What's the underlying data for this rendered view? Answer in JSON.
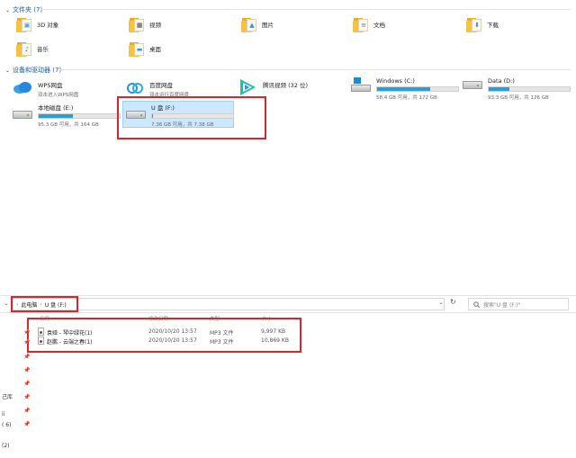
{
  "folders_section": {
    "title": "文件夹 (7)",
    "items": [
      {
        "label": "3D 对象",
        "icon": "3d-objects-icon",
        "glyph": "▣",
        "glyph_color": "#4aa3df"
      },
      {
        "label": "视频",
        "icon": "videos-icon",
        "glyph": "▦",
        "glyph_color": "#444444"
      },
      {
        "label": "图片",
        "icon": "pictures-icon",
        "glyph": "▲",
        "glyph_color": "#3f8fd2"
      },
      {
        "label": "文档",
        "icon": "documents-icon",
        "glyph": "≡",
        "glyph_color": "#5a7fa8"
      },
      {
        "label": "下载",
        "icon": "downloads-icon",
        "glyph": "⬇",
        "glyph_color": "#2f7fd0"
      },
      {
        "label": "音乐",
        "icon": "music-icon",
        "glyph": "♪",
        "glyph_color": "#2f7fd0"
      },
      {
        "label": "桌面",
        "icon": "desktop-icon",
        "glyph": "▬",
        "glyph_color": "#3a9ae0"
      }
    ]
  },
  "devices_section": {
    "title": "设备和驱动器 (7)",
    "items": [
      {
        "name": "WPS网盘",
        "sub": "双击进入WPS网盘",
        "icon": "wps-cloud-icon"
      },
      {
        "name": "百度网盘",
        "sub": "双击运行百度网盘",
        "icon": "baidu-netdisk-icon"
      },
      {
        "name": "腾讯视频 (32 位)",
        "sub": "",
        "icon": "tencent-video-icon"
      },
      {
        "name": "Windows (C:)",
        "sub": "58.4 GB 可用，共 172 GB",
        "icon": "windows-drive-icon",
        "used": 0.66
      },
      {
        "name": "Data (D:)",
        "sub": "93.3 GB 可用，共 126 GB",
        "icon": "hard-drive-icon",
        "used": 0.26
      },
      {
        "name": "本地磁盘 (E:)",
        "sub": "95.3 GB 可用，共 164 GB",
        "icon": "hard-drive-icon",
        "used": 0.42
      },
      {
        "name": "U 盘 (F:)",
        "sub": "7.36 GB 可用，共 7.38 GB",
        "icon": "usb-drive-icon",
        "used": 0.003
      }
    ]
  },
  "address_bar": {
    "crumbs": [
      "此电脑",
      "U 盘 (F:)"
    ],
    "search_placeholder": "搜索\"U 盘 (F:)\""
  },
  "file_list": {
    "columns": [
      "名称",
      "修改日期",
      "类型",
      "大小"
    ],
    "rows": [
      {
        "name": "袁娅 - 琴中绿花(1)",
        "date": "2020/10/20 13:57",
        "type": "MP3 文件",
        "size": "9,997 KB"
      },
      {
        "name": "赵鹏 - 云端之春(1)",
        "date": "2020/10/20 13:57",
        "type": "MP3 文件",
        "size": "10,869 KB"
      }
    ]
  },
  "left_nav": [
    "己库",
    "ii",
    "( 6)",
    "(2)"
  ],
  "colors": {
    "accent": "#26a0da",
    "highlight_box": "#d9252b",
    "selection": "#cce8ff"
  }
}
